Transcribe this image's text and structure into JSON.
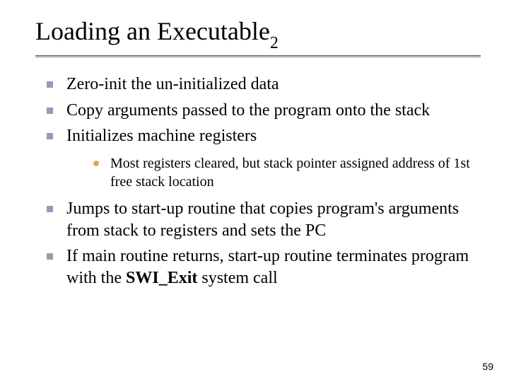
{
  "title": {
    "main": "Loading an Executable",
    "sub": "2"
  },
  "bullets": {
    "b0": "Zero-init the un-initialized data",
    "b1": "Copy arguments passed to the program onto the stack",
    "b2": "Initializes machine registers",
    "b2_0": "Most registers cleared, but stack pointer assigned address of 1st free stack location",
    "b3": "Jumps to start-up routine that copies program's arguments from stack to registers and sets the PC",
    "b4_pre": "If main routine returns, start-up routine terminates program with the ",
    "b4_bold": "SWI_Exit",
    "b4_post": " system call"
  },
  "page_number": "59"
}
